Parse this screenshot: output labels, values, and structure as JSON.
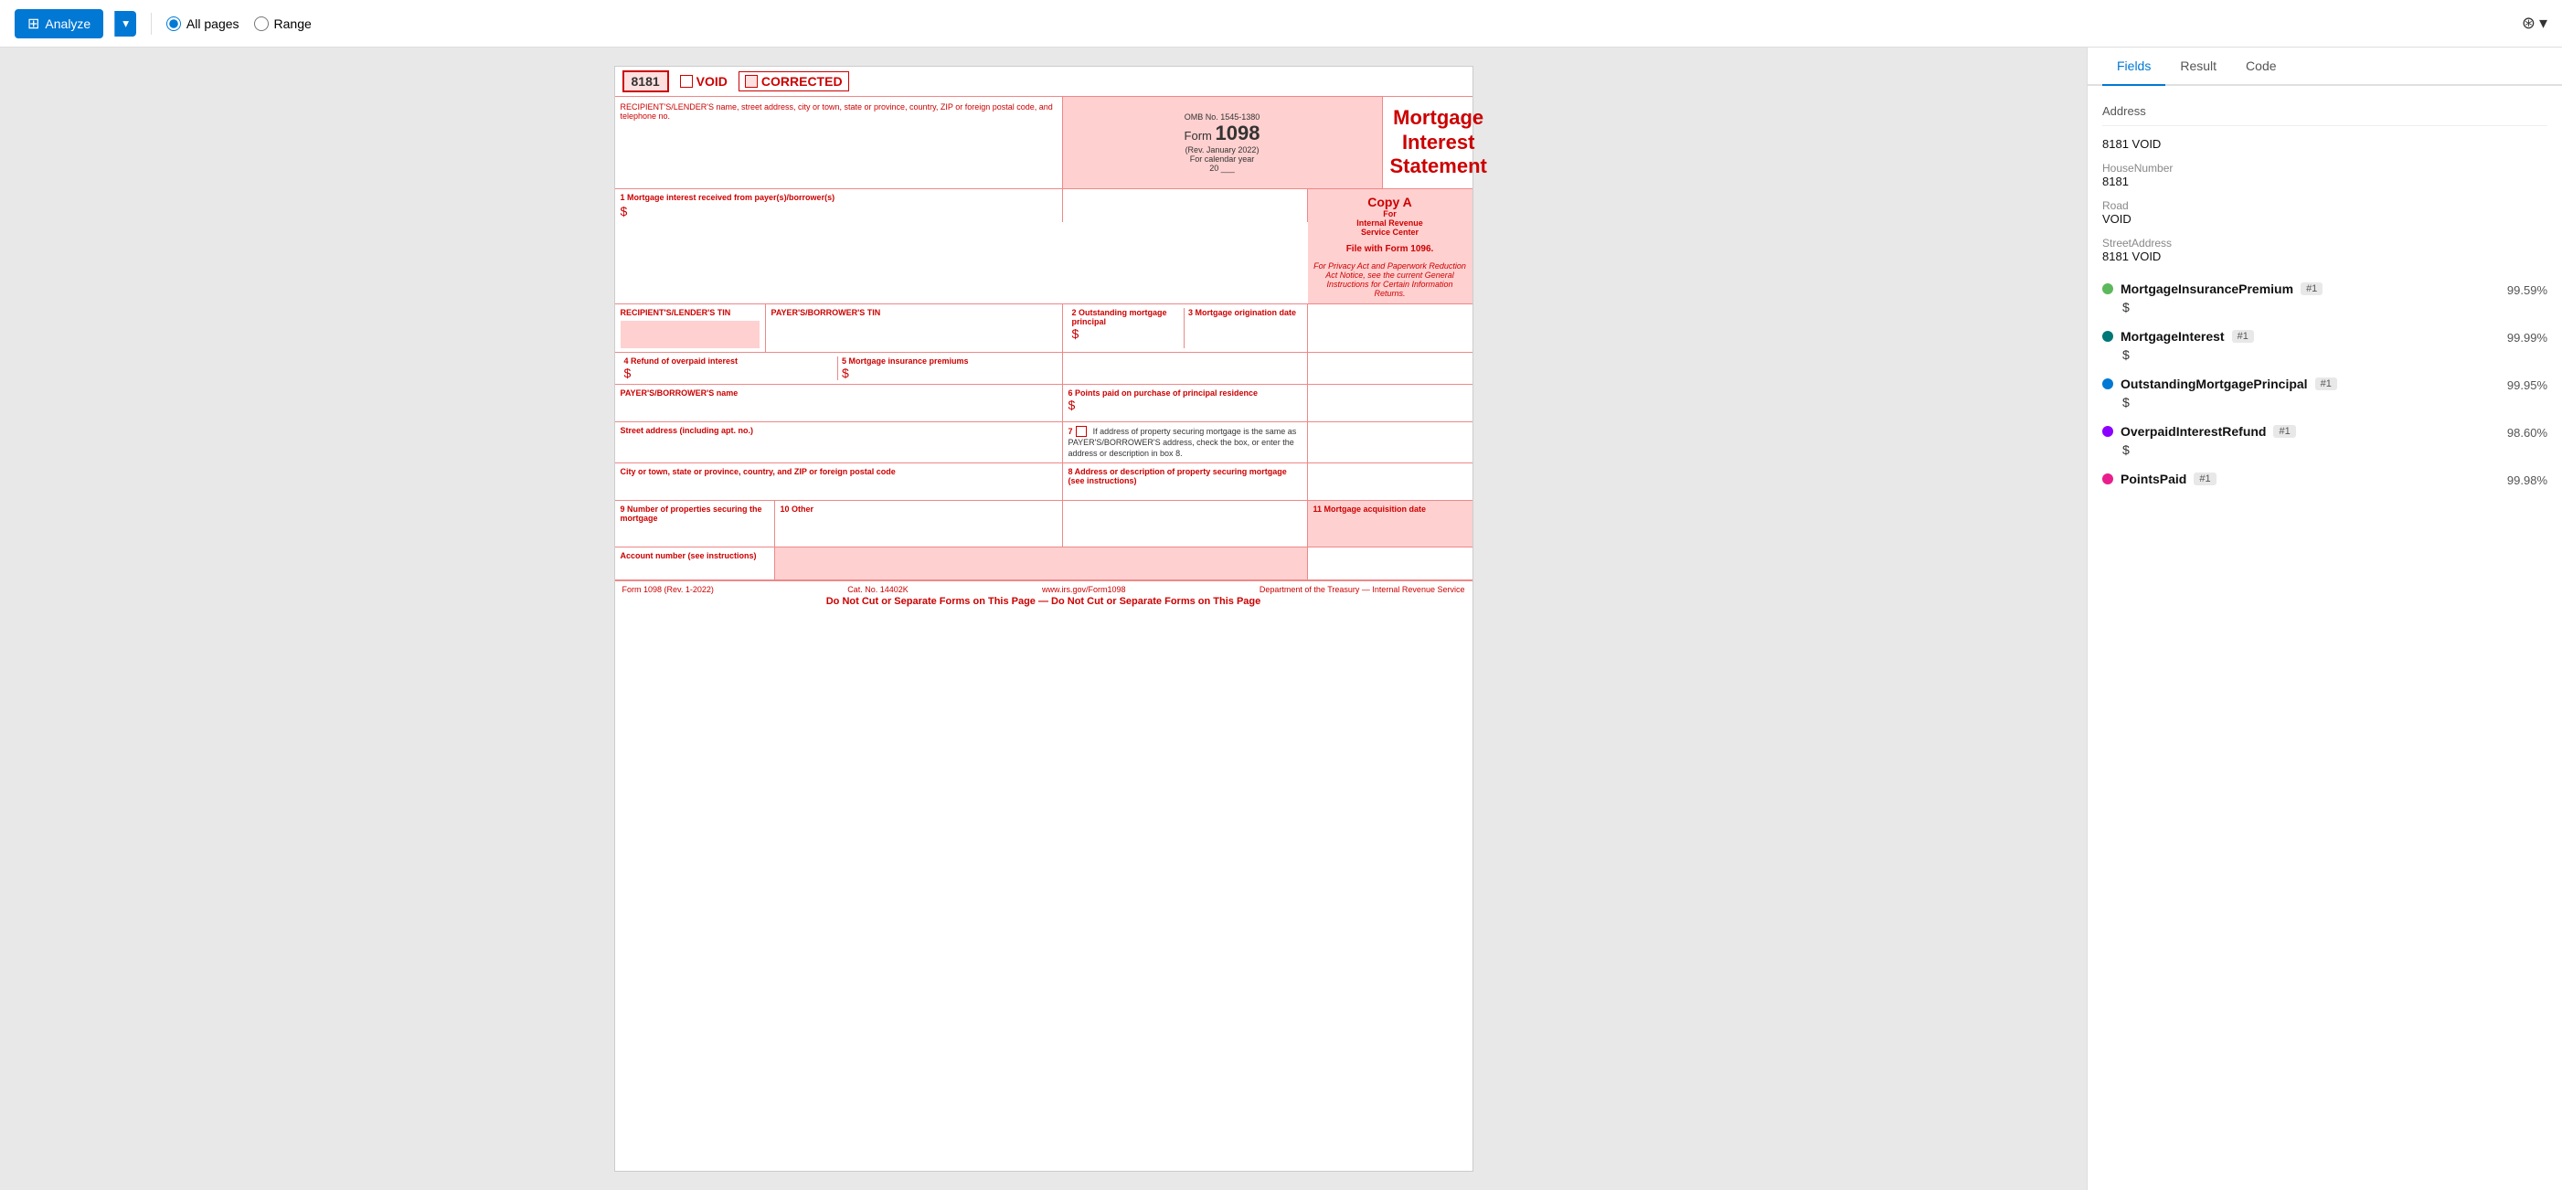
{
  "toolbar": {
    "analyze_label": "Analyze",
    "all_pages_label": "All pages",
    "range_label": "Range"
  },
  "form": {
    "form_id": "8181",
    "void_label": "VOID",
    "corrected_label": "CORRECTED",
    "omb_no": "OMB No. 1545-1380",
    "form_number": "1098",
    "rev_date": "(Rev. January 2022)",
    "cal_year_label": "For calendar year",
    "cal_year": "20 ___",
    "title_line1": "Mortgage",
    "title_line2": "Interest",
    "title_line3": "Statement",
    "copy_a": "Copy A",
    "copy_a_for": "For",
    "copy_a_irs": "Internal Revenue",
    "copy_a_service": "Service Center",
    "file_with": "File with Form 1096.",
    "privacy_notice": "For Privacy Act and Paperwork Reduction Act Notice, see the current General Instructions for Certain Information Returns.",
    "recipient_label": "RECIPIENT'S/LENDER'S name, street address, city or town, state or province, country, ZIP or foreign postal code, and telephone no.",
    "recipient_tin_label": "RECIPIENT'S/LENDER'S TIN",
    "payer_tin_label": "PAYER'S/BORROWER'S TIN",
    "payer_name_label": "PAYER'S/BORROWER'S name",
    "street_label": "Street address (including apt. no.)",
    "city_label": "City or town, state or province, country, and ZIP or foreign postal code",
    "box1_label": "1 Mortgage interest received from payer(s)/borrower(s)",
    "box2_label": "2 Outstanding mortgage principal",
    "box3_label": "3 Mortgage origination date",
    "box4_label": "4 Refund of overpaid interest",
    "box5_label": "5 Mortgage insurance premiums",
    "box6_label": "6 Points paid on purchase of principal residence",
    "box7_label": "7",
    "box7_text": "If address of property securing mortgage is the same as PAYER'S/BORROWER'S address, check the box, or enter the address or description in box 8.",
    "box8_label": "8 Address or description of property securing mortgage (see instructions)",
    "box9_label": "9 Number of properties securing the mortgage",
    "box10_label": "10 Other",
    "box11_label": "11 Mortgage acquisition date",
    "acct_label": "Account number (see instructions)",
    "footer_form": "Form 1098 (Rev. 1-2022)",
    "footer_cat": "Cat. No. 14402K",
    "footer_url": "www.irs.gov/Form1098",
    "footer_dept": "Department of the Treasury — Internal Revenue Service",
    "footer_donotcut": "Do Not Cut or Separate Forms on This Page — Do Not Cut or Separate Forms on This Page"
  },
  "panel": {
    "tabs": [
      "Fields",
      "Result",
      "Code"
    ],
    "active_tab": "Fields",
    "address_section": "Address",
    "address_8181_void": "8181 VOID",
    "house_number_label": "HouseNumber",
    "house_number_val": "8181",
    "road_label": "Road",
    "road_val": "VOID",
    "street_address_label": "StreetAddress",
    "street_address_val": "8181 VOID",
    "fields": [
      {
        "name": "MortgageInsurancePremium",
        "tag": "#1",
        "confidence": "99.59%",
        "value": "$",
        "dot_color": "green"
      },
      {
        "name": "MortgageInterest",
        "tag": "#1",
        "confidence": "99.99%",
        "value": "$",
        "dot_color": "teal"
      },
      {
        "name": "OutstandingMortgagePrincipal",
        "tag": "#1",
        "confidence": "99.95%",
        "value": "$",
        "dot_color": "blue"
      },
      {
        "name": "OverpaidInterestRefund",
        "tag": "#1",
        "confidence": "98.60%",
        "value": "$",
        "dot_color": "purple"
      },
      {
        "name": "PointsPaid",
        "tag": "#1",
        "confidence": "99.98%",
        "value": "",
        "dot_color": "pink"
      }
    ]
  }
}
